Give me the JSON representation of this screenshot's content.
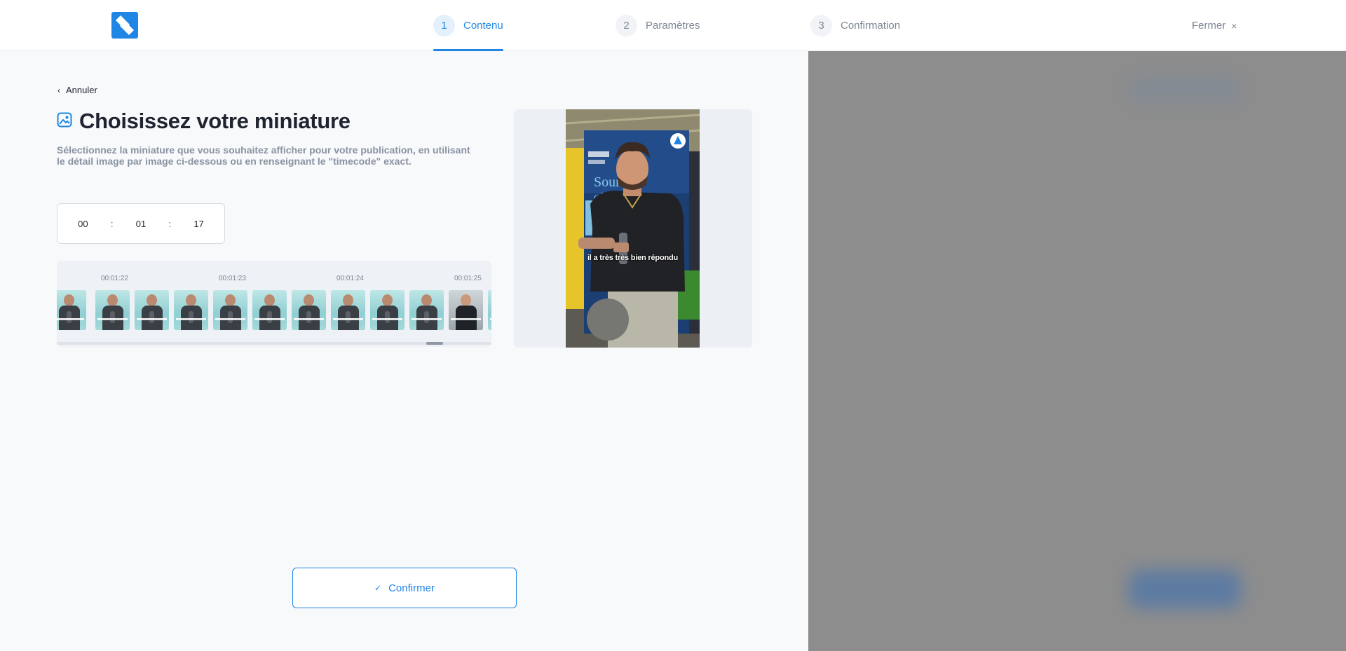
{
  "colors": {
    "accent": "#1f86e6",
    "panel_bg": "#f7f9fb",
    "overlay_bg": "#8d8d8d",
    "muted_text": "#8a93a2"
  },
  "header": {
    "logo_icon": "brand-logo-icon",
    "steps": [
      {
        "num": "1",
        "label": "Contenu",
        "active": true
      },
      {
        "num": "2",
        "label": "Paramètres",
        "active": false
      },
      {
        "num": "3",
        "label": "Confirmation",
        "active": false
      }
    ],
    "close_label": "Fermer",
    "close_icon": "×"
  },
  "main": {
    "back_icon": "‹",
    "back_label": "Annuler",
    "title_icon": "image-icon",
    "title": "Choisissez votre miniature",
    "description": "Sélectionnez la miniature que vous souhaitez afficher pour votre publication, en utilisant le détail image par image ci-dessous ou en renseignant le \"timecode\" exact.",
    "timecode": {
      "hours": "00",
      "minutes": "01",
      "seconds": "17",
      "separator": ":"
    },
    "timeline_labels": [
      "00:01:22",
      "00:01:23",
      "00:01:24",
      "00:01:25"
    ],
    "preview_caption": "il a très très bien répondu",
    "confirm_icon": "✓",
    "confirm_label": "Confirmer"
  }
}
